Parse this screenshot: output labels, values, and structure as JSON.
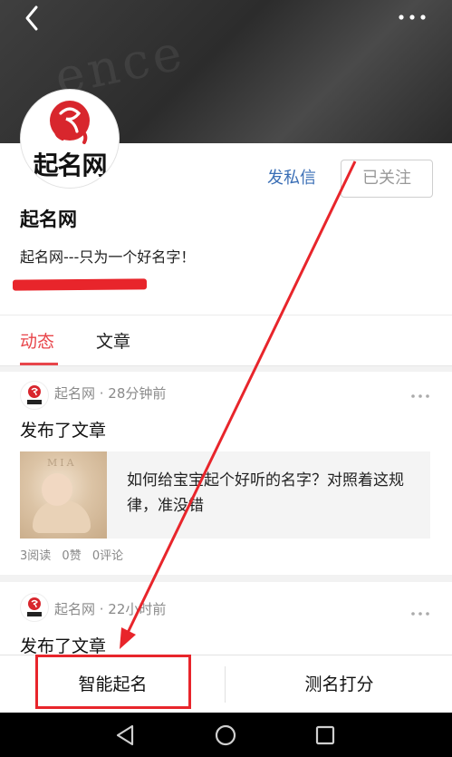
{
  "header": {
    "back_icon": "chevron-left-icon",
    "more_icon": "more-horizontal-icon"
  },
  "profile": {
    "avatar_text": "起名网",
    "name": "起名网",
    "bio": "起名网---只为一个好名字！",
    "message_button": "发私信",
    "follow_button": "已关注"
  },
  "tabs": [
    {
      "label": "动态",
      "active": true
    },
    {
      "label": "文章",
      "active": false
    }
  ],
  "posts": [
    {
      "meta": "起名网 · 28分钟前",
      "action": "发布了文章",
      "article_title": "如何给宝宝起个好听的名字？对照着这规律，准没错",
      "thumb_text": "MIA",
      "stats": [
        "3阅读",
        "0赞",
        "0评论"
      ]
    },
    {
      "meta": "起名网 · 22小时前",
      "action": "发布了文章"
    }
  ],
  "bottom_bar": {
    "left_button": "智能起名",
    "right_button": "测名打分"
  },
  "colors": {
    "accent_red": "#e8454a",
    "annotation_red": "#e8252b",
    "link_blue": "#3b6fb6"
  }
}
